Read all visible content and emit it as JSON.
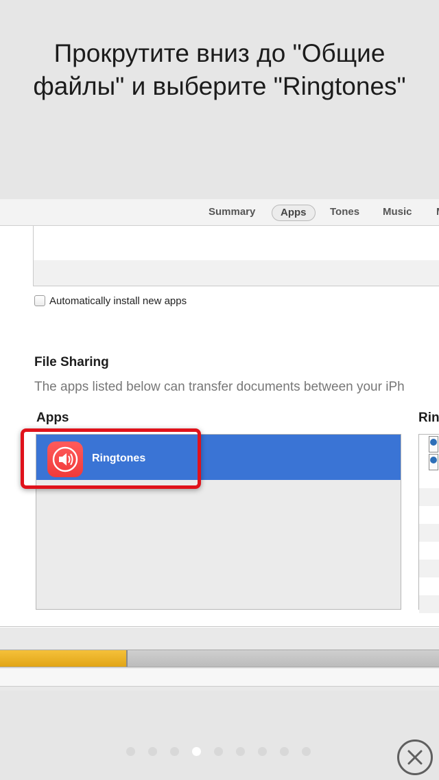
{
  "instruction": {
    "line1": "Прокрутите вниз до \"Общие",
    "line2": "файлы\" и выберите \"Ringtones\""
  },
  "tabs": [
    {
      "label": "Summary",
      "active": false
    },
    {
      "label": "Apps",
      "active": true
    },
    {
      "label": "Tones",
      "active": false
    },
    {
      "label": "Music",
      "active": false
    },
    {
      "label": "M",
      "active": false
    }
  ],
  "auto_install": {
    "label": "Automatically install new apps",
    "checked": false
  },
  "file_sharing": {
    "title": "File Sharing",
    "description": "The apps listed below can transfer documents between your iPh",
    "apps_header": "Apps",
    "right_header": "Rin",
    "apps": [
      {
        "name": "Ringtones",
        "icon": "speaker-icon",
        "selected": true
      }
    ]
  },
  "capacity": {
    "used_fraction": 0.29
  },
  "pager": {
    "count": 9,
    "current": 4
  },
  "colors": {
    "selection": "#3a74d5",
    "highlight": "#e0121b",
    "app_icon": "#f03a3a",
    "capacity": "#e1a517"
  }
}
